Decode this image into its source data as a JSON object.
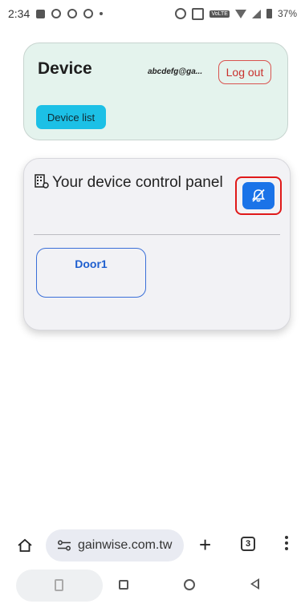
{
  "status_bar": {
    "time": "2:34",
    "battery": "37%"
  },
  "device_card": {
    "title": "Device",
    "user_email": "abcdefg@ga...",
    "logout_label": "Log out",
    "device_list_label": "Device list"
  },
  "control_panel": {
    "heading": "Your device control panel",
    "notification_icon": "bell-off-icon",
    "doors": [
      {
        "label": "Door1"
      }
    ]
  },
  "browser": {
    "url": "gainwise.com.tw",
    "tab_count": "3"
  },
  "colors": {
    "accent_blue": "#1a73e8",
    "device_card_bg": "#e4f3ed",
    "device_list_bg": "#1cc0e6",
    "logout_red": "#c9302c",
    "highlight_red": "#e01919"
  }
}
